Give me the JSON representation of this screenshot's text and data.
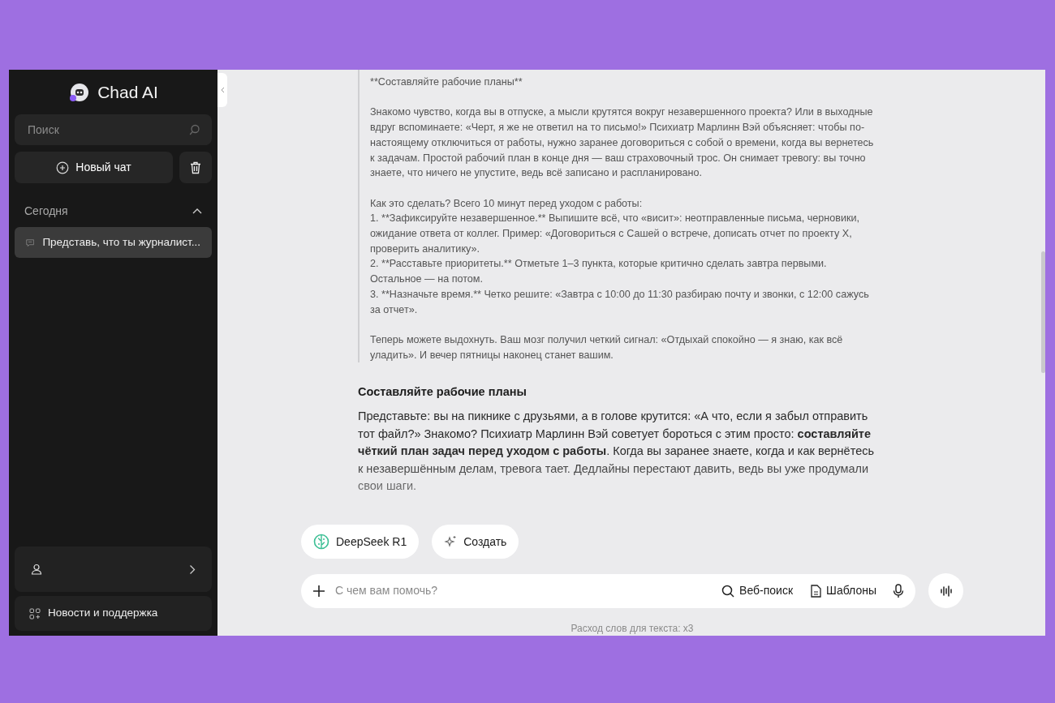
{
  "sidebar": {
    "brand": "Chad AI",
    "search": {
      "placeholder": "Поиск"
    },
    "new_chat": "Новый чат",
    "section": {
      "title": "Сегодня",
      "expanded": true
    },
    "history": [
      {
        "title": "Представь, что ты журналист...",
        "selected": true
      }
    ],
    "news": "Новости и поддержка"
  },
  "chat": {
    "quote": [
      [
        "**Составляйте рабочие планы**"
      ],
      [
        "Знакомо чувство, когда вы в отпуске, а мысли крутятся вокруг незавершенного проекта? Или в выходные вдруг вспоминаете: «Черт, я же не ответил на то письмо!» Психиатр Марлинн Вэй объясняет: чтобы по-настоящему отключиться от работы, нужно заранее договориться с собой о времени, когда вы вернетесь к задачам. Простой рабочий план в конце дня — ваш страховочный трос. Он снимает тревогу: вы точно знаете, что ничего не упустите, ведь всё записано и распланировано."
      ],
      [
        "Как это сделать? Всего 10 минут перед уходом с работы:",
        "1. **Зафиксируйте незавершенное.** Выпишите всё, что «висит»: неотправленные письма, черновики, ожидание ответа от коллег. Пример: «Договориться с Сашей о встрече, дописать отчет по проекту X, проверить аналитику».",
        "2. **Расставьте приоритеты.** Отметьте 1–3 пункта, которые критично сделать завтра первыми. Остальное — на потом.",
        "3. **Назначьте время.** Четко решите: «Завтра с 10:00 до 11:30 разбираю почту и звонки, с 12:00 сажусь за отчет»."
      ],
      [
        "Теперь можете выдохнуть. Ваш мозг получил четкий сигнал: «Отдыхай спокойно — я знаю, как всё уладить». И вечер пятницы наконец станет вашим."
      ]
    ],
    "answer": {
      "heading": "Составляйте рабочие планы",
      "text": "Представьте: вы на пикнике с друзьями, а в голове крутится: «А что, если я забыл отправить тот файл?» Знакомо? Психиатр Марлинн Вэй советует бороться с этим просто: **составляйте чёткий план задач перед уходом с работы**. Когда вы заранее знаете, когда и как вернётесь к незавершённым делам, тревога тает. Дедлайны перестают давить, ведь вы уже продумали свои шаги."
    }
  },
  "chips": [
    {
      "label": "DeepSeek R1",
      "kind": "model"
    },
    {
      "label": "Создать",
      "kind": "create"
    }
  ],
  "composer": {
    "placeholder": "С чем вам помочь?",
    "tools": [
      {
        "label": "Веб-поиск",
        "kind": "search"
      },
      {
        "label": "Шаблоны",
        "kind": "templates"
      }
    ]
  },
  "footer": "Расход слов для текста: x3"
}
